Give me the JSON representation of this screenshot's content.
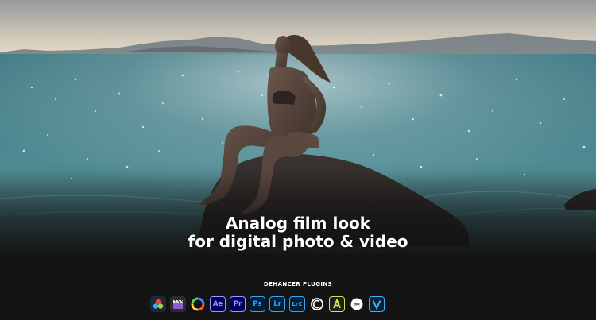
{
  "hero": {
    "headline_line1": "Analog film look",
    "headline_line2": "for digital photo & video"
  },
  "plugins": {
    "label": "DEHANCER PLUGINS",
    "apps": [
      {
        "icon": "davinci-resolve-icon",
        "text": ""
      },
      {
        "icon": "final-cut-pro-icon",
        "text": ""
      },
      {
        "icon": "color-wheel-icon",
        "text": ""
      },
      {
        "icon": "after-effects-icon",
        "text": "Ae"
      },
      {
        "icon": "premiere-pro-icon",
        "text": "Pr"
      },
      {
        "icon": "photoshop-icon",
        "text": "Ps"
      },
      {
        "icon": "lightroom-icon",
        "text": "Lr"
      },
      {
        "icon": "lightroom-classic-icon",
        "text": "LrC"
      },
      {
        "icon": "capture-one-icon",
        "text": ""
      },
      {
        "icon": "affinity-icon",
        "text": ""
      },
      {
        "icon": "ofx-icon",
        "text": ""
      },
      {
        "icon": "vegas-icon",
        "text": ""
      }
    ]
  },
  "colors": {
    "ae_bg": "#00005b",
    "ae_fg": "#9999ff",
    "pr_bg": "#00005b",
    "pr_fg": "#9999ff",
    "ps_bg": "#001e36",
    "ps_fg": "#31a8ff",
    "lr_bg": "#001e36",
    "lr_fg": "#31a8ff",
    "footer": "#141414"
  }
}
